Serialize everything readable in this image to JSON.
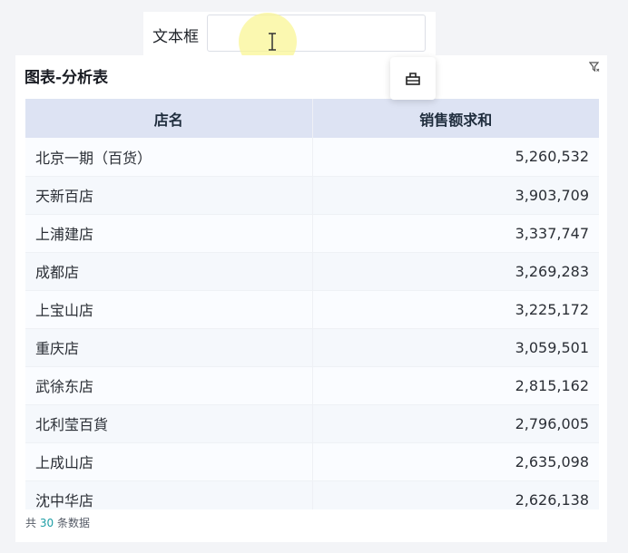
{
  "filter": {
    "label": "文本框",
    "input_value": ""
  },
  "panel": {
    "title": "图表-分析表",
    "filter_icon": "funnel-icon",
    "popup_icon": "toolbar-icon"
  },
  "table": {
    "columns": [
      "店名",
      "销售额求和"
    ],
    "rows": [
      {
        "name": "北京一期（百货）",
        "value": "5,260,532"
      },
      {
        "name": "天新百店",
        "value": "3,903,709"
      },
      {
        "name": "上浦建店",
        "value": "3,337,747"
      },
      {
        "name": "成都店",
        "value": "3,269,283"
      },
      {
        "name": "上宝山店",
        "value": "3,225,172"
      },
      {
        "name": "重庆店",
        "value": "3,059,501"
      },
      {
        "name": "武徐东店",
        "value": "2,815,162"
      },
      {
        "name": "北利莹百貨",
        "value": "2,796,005"
      },
      {
        "name": "上成山店",
        "value": "2,635,098"
      },
      {
        "name": "沈中华店",
        "value": "2,626,138"
      }
    ]
  },
  "footer": {
    "prefix": "共",
    "count": "30",
    "suffix": "条数据"
  }
}
